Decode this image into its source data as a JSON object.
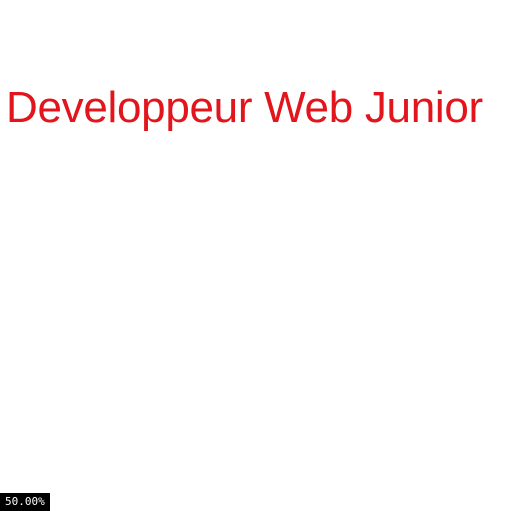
{
  "page": {
    "headline": "Developpeur Web Junior",
    "headline_color": "#e2141c",
    "background_color": "#ffffff"
  },
  "status": {
    "zoom_level": "50.00%"
  }
}
